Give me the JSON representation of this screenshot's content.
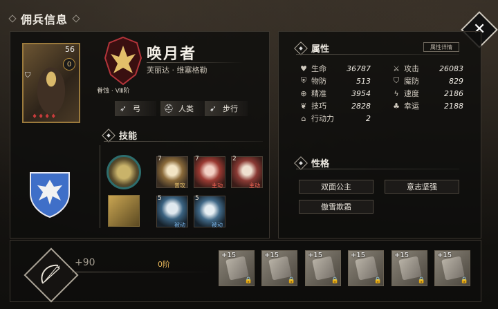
{
  "header": {
    "title": "佣兵信息",
    "close_icon": "close-icon"
  },
  "hero": {
    "level": "56",
    "badge": "0",
    "name": "唤月者",
    "origin": "芙丽达 · 维塞格勒",
    "rank": "眷蚀 · Ⅷ阶",
    "tags": [
      {
        "label": "弓",
        "icon": "bow-icon"
      },
      {
        "label": "人类",
        "icon": "helmet-icon"
      },
      {
        "label": "步行",
        "icon": "boot-icon"
      }
    ]
  },
  "skills": {
    "heading": "技能",
    "items": [
      {
        "num": "7",
        "label": "普攻"
      },
      {
        "num": "7",
        "label": "主动"
      },
      {
        "num": "2",
        "label": "主动"
      },
      {
        "num": "5",
        "label": "被动"
      },
      {
        "num": "5",
        "label": "被动"
      }
    ]
  },
  "attributes": {
    "heading": "属性",
    "detail_label": "属性详情",
    "left": [
      {
        "label": "生命",
        "value": "36787",
        "icon": "heart-icon"
      },
      {
        "label": "物防",
        "value": "513",
        "icon": "shield-icon"
      },
      {
        "label": "精准",
        "value": "3954",
        "icon": "crosshair-icon"
      },
      {
        "label": "技巧",
        "value": "2828",
        "icon": "feather-icon"
      },
      {
        "label": "行动力",
        "value": "2",
        "icon": "boot-icon"
      }
    ],
    "right": [
      {
        "label": "攻击",
        "value": "26083",
        "icon": "swords-icon"
      },
      {
        "label": "魔防",
        "value": "829",
        "icon": "magic-shield-icon"
      },
      {
        "label": "速度",
        "value": "2186",
        "icon": "lightning-icon"
      },
      {
        "label": "幸运",
        "value": "2188",
        "icon": "clover-icon"
      }
    ]
  },
  "personality": {
    "heading": "性格",
    "traits": [
      "双面公主",
      "意志坚强",
      "傲雪欺霜"
    ]
  },
  "weapon": {
    "bonus": "+90",
    "tier": "0阶"
  },
  "equipment": [
    {
      "level": "+15"
    },
    {
      "level": "+15"
    },
    {
      "level": "+15"
    },
    {
      "level": "+15"
    },
    {
      "level": "+15"
    },
    {
      "level": "+15"
    }
  ],
  "colors": {
    "accent_gold": "#e7c06a",
    "active_red": "#ff6a5a",
    "passive_blue": "#7ab4e8"
  }
}
